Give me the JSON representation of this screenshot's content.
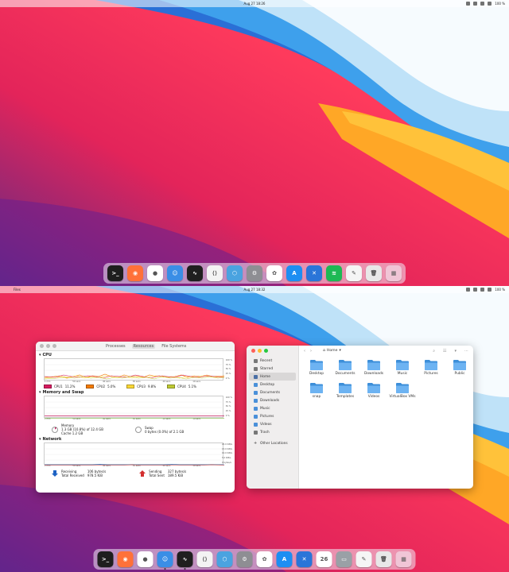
{
  "screen1": {
    "clock": "Aug 27  18:26",
    "battery": "100 %"
  },
  "screen2": {
    "app_name": "Files",
    "clock": "Aug 27  18:32",
    "battery": "100 %"
  },
  "dock1": [
    {
      "name": "terminal",
      "color": "#1e1e1e",
      "glyph": ">_"
    },
    {
      "name": "firefox",
      "color": "#ff7139",
      "glyph": "◉"
    },
    {
      "name": "chrome",
      "color": "#ffffff",
      "glyph": "●"
    },
    {
      "name": "finder",
      "color": "#3a8ee6",
      "glyph": "☺"
    },
    {
      "name": "system-monitor",
      "color": "#1f1f1f",
      "glyph": "∿"
    },
    {
      "name": "vscode",
      "color": "#f3f3f3",
      "glyph": "⟨⟩"
    },
    {
      "name": "hex-app",
      "color": "#4aa3e0",
      "glyph": "⬡"
    },
    {
      "name": "settings",
      "color": "#8e8e93",
      "glyph": "⚙"
    },
    {
      "name": "photos",
      "color": "#ffffff",
      "glyph": "✿"
    },
    {
      "name": "app-store",
      "color": "#1d8ef2",
      "glyph": "A"
    },
    {
      "name": "xcode",
      "color": "#2a75d8",
      "glyph": "✕"
    },
    {
      "name": "spotify",
      "color": "#1db954",
      "glyph": "≋"
    },
    {
      "name": "text-editor",
      "color": "#f5f5f5",
      "glyph": "✎"
    },
    {
      "name": "trash",
      "color": "#e8e8e8",
      "glyph": "🗑"
    },
    {
      "name": "app-grid",
      "color": "#f0c5d6",
      "glyph": "▦"
    }
  ],
  "dock2": [
    {
      "name": "terminal",
      "color": "#1e1e1e",
      "glyph": ">_"
    },
    {
      "name": "firefox",
      "color": "#ff7139",
      "glyph": "◉"
    },
    {
      "name": "chrome",
      "color": "#ffffff",
      "glyph": "●"
    },
    {
      "name": "finder",
      "color": "#3a8ee6",
      "glyph": "☺"
    },
    {
      "name": "system-monitor",
      "color": "#1f1f1f",
      "glyph": "∿"
    },
    {
      "name": "vscode",
      "color": "#f3f3f3",
      "glyph": "⟨⟩"
    },
    {
      "name": "hex-app",
      "color": "#4aa3e0",
      "glyph": "⬡"
    },
    {
      "name": "settings",
      "color": "#8e8e93",
      "glyph": "⚙"
    },
    {
      "name": "photos",
      "color": "#ffffff",
      "glyph": "✿"
    },
    {
      "name": "app-store",
      "color": "#1d8ef2",
      "glyph": "A"
    },
    {
      "name": "xcode",
      "color": "#2a75d8",
      "glyph": "✕"
    },
    {
      "name": "calendar",
      "color": "#ffffff",
      "glyph": "26"
    },
    {
      "name": "disk",
      "color": "#9aa0a6",
      "glyph": "▭"
    },
    {
      "name": "text-editor",
      "color": "#f5f5f5",
      "glyph": "✎"
    },
    {
      "name": "trash",
      "color": "#e8e8e8",
      "glyph": "🗑"
    },
    {
      "name": "app-grid",
      "color": "#f0c5d6",
      "glyph": "▦"
    }
  ],
  "monitor": {
    "tabs": [
      "Processes",
      "Resources",
      "File Systems"
    ],
    "cpu_title": "CPU",
    "mem_title": "Memory and Swap",
    "net_title": "Network",
    "pct_ticks": [
      "100 %",
      "75 %",
      "50 %",
      "25 %",
      "0 %"
    ],
    "net_ticks": [
      "20.0 KiB/s",
      "15.0 KiB/s",
      "10.0 KiB/s",
      "5.0 KiB/s",
      "0 bytes/s"
    ],
    "x_ticks": [
      "1 min",
      "50 secs",
      "40 secs",
      "30 secs",
      "20 secs",
      "10 secs",
      ""
    ],
    "cpus": [
      {
        "label": "CPU1",
        "value": "11.2%",
        "color": "#d81b60"
      },
      {
        "label": "CPU2",
        "value": "5.0%",
        "color": "#f57c00"
      },
      {
        "label": "CPU3",
        "value": "9.8%",
        "color": "#fdd835"
      },
      {
        "label": "CPU4",
        "value": "5.1%",
        "color": "#c0ca33"
      }
    ],
    "memory": {
      "label": "Memory",
      "line1": "1.3 GB (10.8%) of 12.4 GB",
      "line2": "Cache 1.2 GB"
    },
    "swap": {
      "label": "Swap",
      "line1": "0 bytes (0.0%) of 2.1 GB"
    },
    "receiving": {
      "label": "Receiving",
      "rate": "106 bytes/s",
      "total_label": "Total Received",
      "total": "978.5 KiB"
    },
    "sending": {
      "label": "Sending",
      "rate": "327 bytes/s",
      "total_label": "Total Sent",
      "total": "189.5 KiB"
    }
  },
  "files": {
    "path": "Home",
    "sidebar": [
      "Recent",
      "Starred",
      "Home",
      "Desktop",
      "Documents",
      "Downloads",
      "Music",
      "Pictures",
      "Videos",
      "Trash",
      "Other Locations"
    ],
    "folders": [
      "Desktop",
      "Documents",
      "Downloads",
      "Music",
      "Pictures",
      "Public",
      "snap",
      "Templates",
      "Videos",
      "VirtualBox VMs"
    ]
  }
}
